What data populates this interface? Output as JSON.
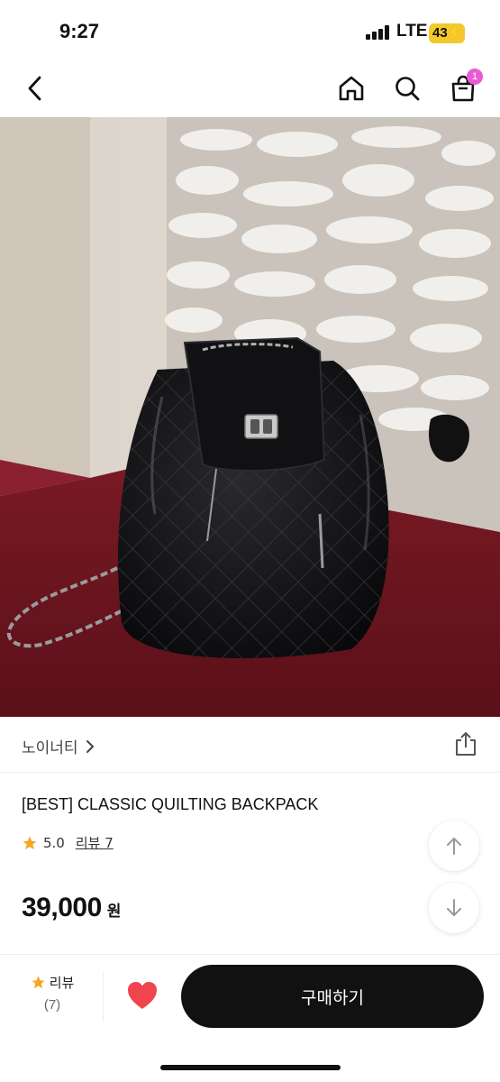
{
  "status_bar": {
    "time": "9:27",
    "network": "LTE",
    "battery": "43"
  },
  "nav": {
    "cart_badge": "1"
  },
  "brand": {
    "name": "노이너티",
    "chevron": "›"
  },
  "product": {
    "title": "[BEST] CLASSIC QUILTING BACKPACK",
    "rating": "5.0",
    "review_link": "리뷰 7",
    "price": "39,000",
    "currency": "원"
  },
  "bottom_bar": {
    "review_label": "리뷰",
    "review_count": "(7)",
    "buy_label": "구매하기"
  },
  "colors": {
    "accent_black": "#111111",
    "star": "#f5a623",
    "heart": "#f0444e",
    "badge": "#e85cd3",
    "battery": "#f3c82a"
  },
  "icons": [
    "back-arrow-icon",
    "home-icon",
    "search-icon",
    "shopping-bag-icon",
    "share-icon",
    "star-icon",
    "arrow-up-icon",
    "arrow-down-icon",
    "heart-icon",
    "chevron-right-icon"
  ]
}
